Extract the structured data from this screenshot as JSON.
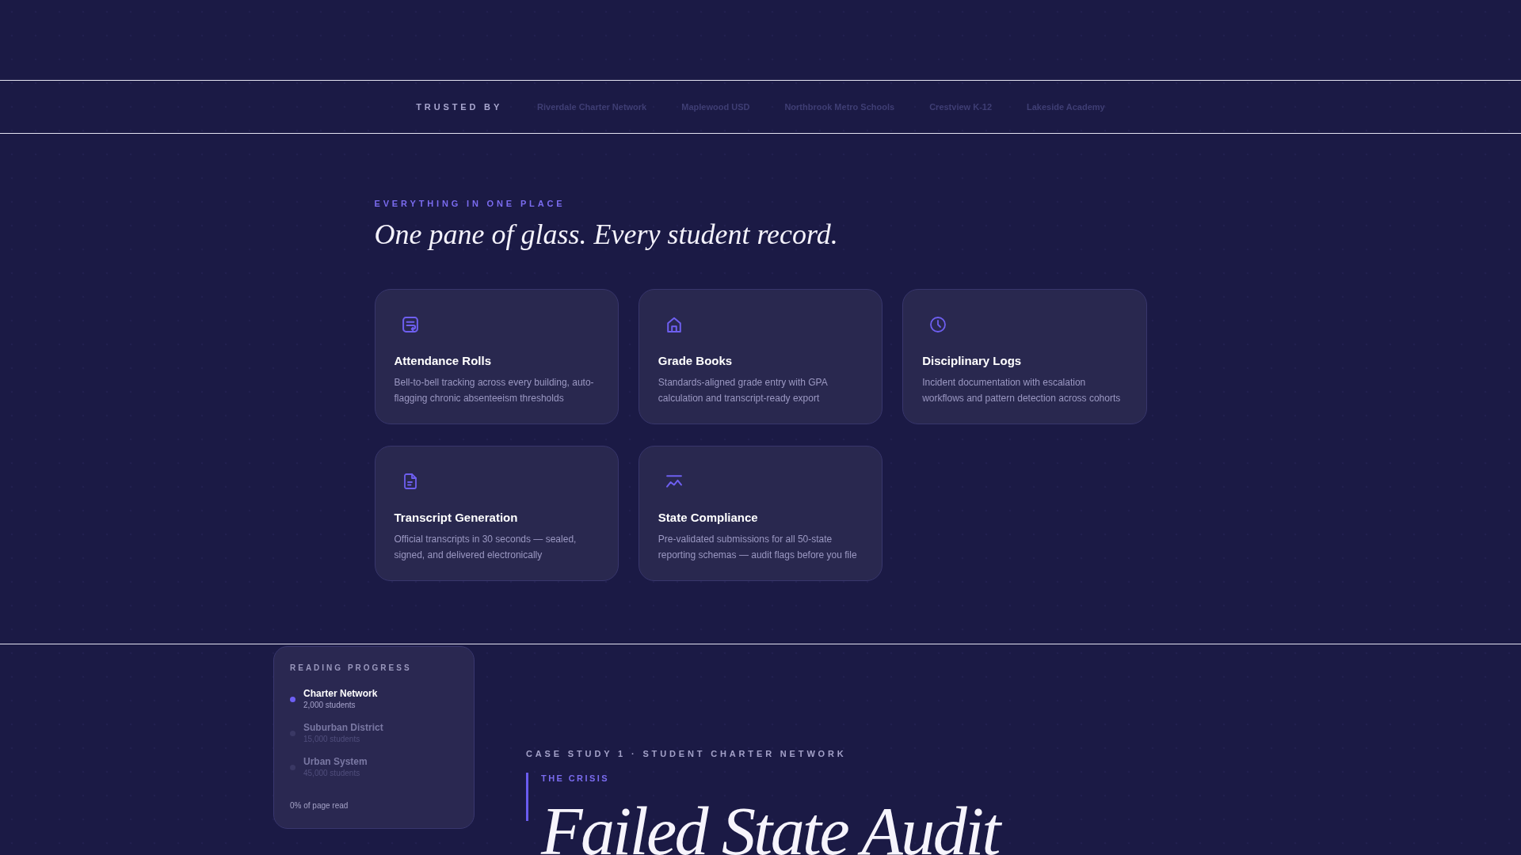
{
  "trusted_by": {
    "label": "TRUSTED BY",
    "logos": [
      "Riverdale Charter Network",
      "Maplewood USD",
      "Northbrook Metro Schools",
      "Crestview K-12",
      "Lakeside Academy"
    ]
  },
  "features": {
    "eyebrow": "EVERYTHING IN ONE PLACE",
    "title": "One pane of glass. Every student record.",
    "cards": [
      {
        "title": "Attendance Rolls",
        "description": "Bell-to-bell tracking across every building, auto-flagging chronic absenteeism thresholds"
      },
      {
        "title": "Grade Books",
        "description": "Standards-aligned grade entry with GPA calculation and transcript-ready export"
      },
      {
        "title": "Disciplinary Logs",
        "description": "Incident documentation with escalation workflows and pattern detection across cohorts"
      },
      {
        "title": "Transcript Generation",
        "description": "Official transcripts in 30 seconds — sealed, signed, and delivered electronically"
      },
      {
        "title": "State Compliance",
        "description": "Pre-validated submissions for all 50-state reporting schemas — audit flags before you file"
      }
    ]
  },
  "reading_progress": {
    "title": "READING PROGRESS",
    "items": [
      {
        "name": "Charter Network",
        "detail": "2,000 students",
        "selected": true
      },
      {
        "name": "Suburban District",
        "detail": "15,000 students",
        "selected": false
      },
      {
        "name": "Urban System",
        "detail": "45,000 students",
        "selected": false
      }
    ],
    "status": "0% of page read"
  },
  "case_study": {
    "label": "CASE STUDY 1 · STUDENT CHARTER NETWORK",
    "eyebrow": "THE CRISIS",
    "title": "Failed State Audit"
  }
}
